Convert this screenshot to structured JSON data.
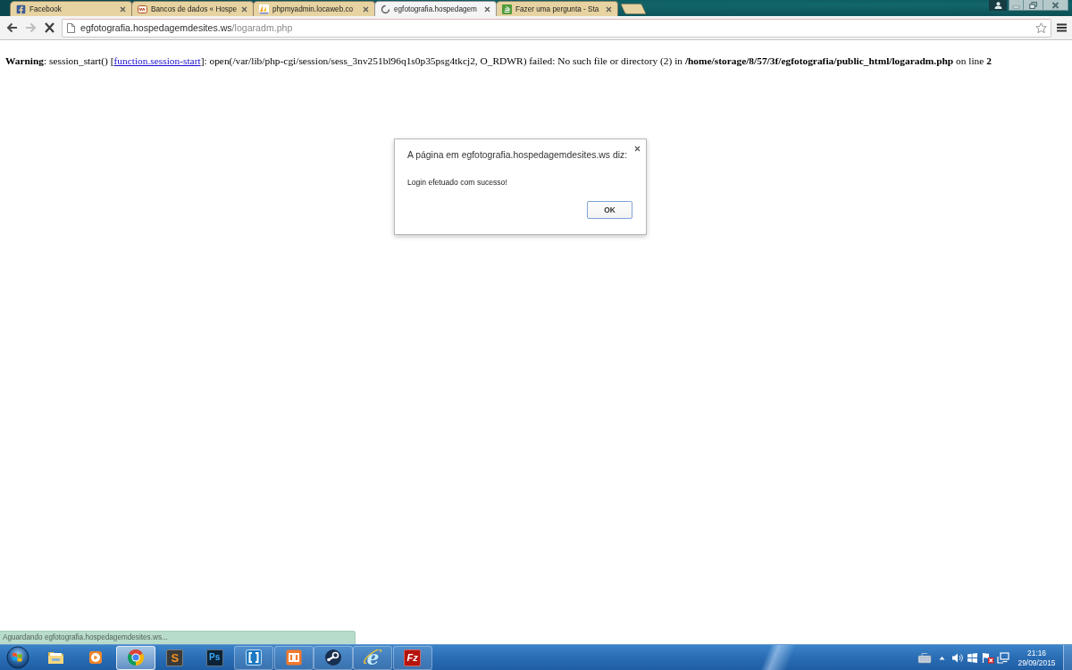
{
  "browser": {
    "tabs": [
      {
        "title": "Facebook",
        "kind": "facebook",
        "selected": false
      },
      {
        "title": "Bancos de dados « Hospe",
        "kind": "locaweb",
        "selected": false
      },
      {
        "title": "phpmyadmin.locaweb.co",
        "kind": "pma",
        "selected": false
      },
      {
        "title": "egfotografia.hospedagem",
        "kind": "loading",
        "selected": true
      },
      {
        "title": "Fazer uma pergunta - Sta",
        "kind": "stack",
        "selected": false
      }
    ],
    "toolbar": {
      "back_disabled": false,
      "forward_disabled": true,
      "loading": true,
      "bookmarked": false
    },
    "address": {
      "host": "egfotografia.hospedagemdesites.ws",
      "path": "/logaradm.php"
    }
  },
  "page": {
    "warning": {
      "before": "**Warning**: session_start() [",
      "link": "function.session-start",
      "after": "]: open(/var/lib/php-cgi/session/sess_3nv251bl96q1s0p35psg4tkcj2, O_RDWR) failed: No such file or directory (2) in **/home/storage/8/57/3f/egfotografia/public_html/logaradm.php** on line **2**"
    }
  },
  "dialog": {
    "title": "A página em egfotografia.hospedagemdesites.ws diz:",
    "message": "Login efetuado com sucesso!",
    "button": "OK"
  },
  "status_bubble": "Aguardando egfotografia.hospedagemdesites.ws...",
  "taskbar": {
    "apps": [
      {
        "kind": "explorer",
        "running": false,
        "selected": false
      },
      {
        "kind": "media",
        "running": false,
        "selected": false
      },
      {
        "kind": "chrome",
        "running": true,
        "selected": true
      },
      {
        "kind": "sublime",
        "glyph": "S",
        "running": false,
        "selected": false
      },
      {
        "kind": "photoshop",
        "glyph": "Ps",
        "running": false,
        "selected": false
      },
      {
        "kind": "brackets",
        "running": true,
        "selected": false
      },
      {
        "kind": "xampp",
        "running": true,
        "selected": false
      },
      {
        "kind": "steam",
        "running": true,
        "selected": false
      },
      {
        "kind": "ie",
        "glyph": "e",
        "running": true,
        "selected": false
      },
      {
        "kind": "filezilla",
        "glyph": "Fz",
        "running": true,
        "selected": false
      }
    ],
    "clock": {
      "time": "21:16",
      "date": "29/09/2015"
    }
  }
}
